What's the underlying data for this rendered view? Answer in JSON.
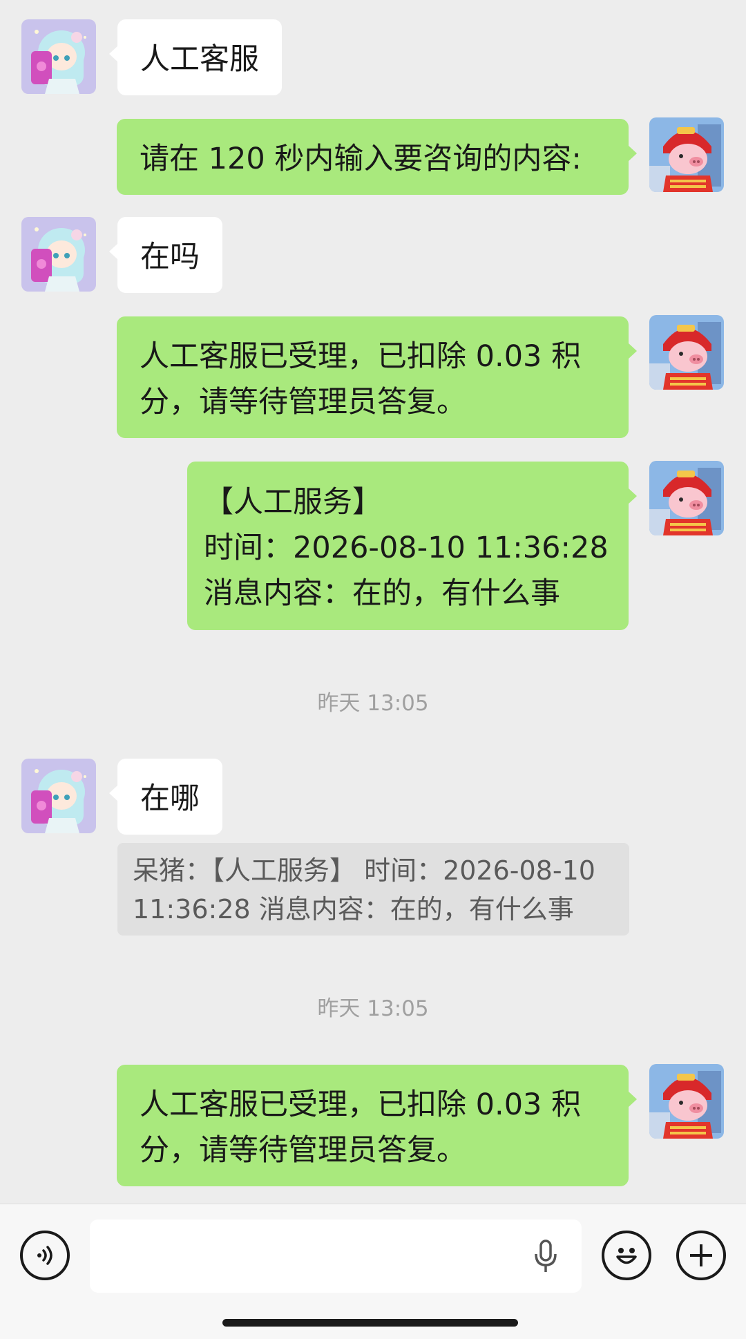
{
  "messages": [
    {
      "side": "left",
      "avatar": "girl-avatar",
      "text": "人工客服"
    },
    {
      "side": "right",
      "avatar": "pig-avatar",
      "text": "请在 120 秒内输入要咨询的内容:"
    },
    {
      "side": "left",
      "avatar": "girl-avatar",
      "text": "在吗"
    },
    {
      "side": "right",
      "avatar": "pig-avatar",
      "text": "人工客服已受理，已扣除 0.03 积分，请等待管理员答复。"
    },
    {
      "side": "right",
      "avatar": "pig-avatar",
      "text": "【人工服务】\n时间：2026-08-10 11:36:28\n消息内容：在的，有什么事"
    },
    {
      "side": "left",
      "avatar": "girl-avatar",
      "text": "在哪"
    },
    {
      "side": "right",
      "avatar": "pig-avatar",
      "text": "人工客服已受理，已扣除 0.03 积分，请等待管理员答复。"
    }
  ],
  "quoted_message": {
    "text": "呆猪：【人工服务】 时间：2026-08-10 11:36:28 消息内容：在的，有什么事"
  },
  "timestamps": [
    "昨天 13:05",
    "昨天 13:05"
  ],
  "input_bar": {
    "voice_icon": "voice-mode-icon",
    "mic_icon": "microphone-icon",
    "emoji_icon": "emoji-icon",
    "plus_icon": "plus-icon",
    "input_value": ""
  },
  "colors": {
    "background": "#ededed",
    "sent_bubble": "#a9e97d",
    "received_bubble": "#ffffff"
  }
}
